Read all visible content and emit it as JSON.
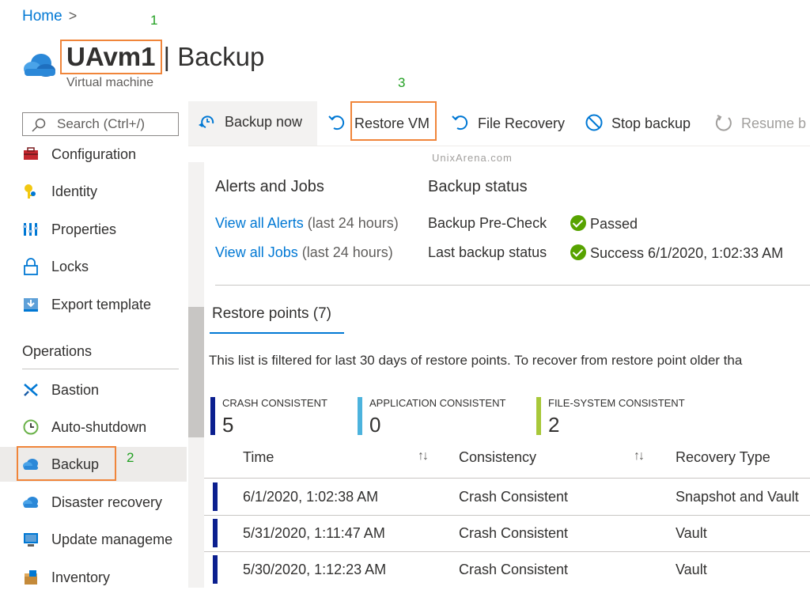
{
  "breadcrumb": {
    "home": "Home",
    "separator": ">"
  },
  "annotations": {
    "a1": "1",
    "a2": "2",
    "a3": "3"
  },
  "header": {
    "resource_name": "UAvm1",
    "blade": "| Backup",
    "subtitle": "Virtual machine"
  },
  "search": {
    "placeholder": "Search (Ctrl+/)"
  },
  "sidebar": {
    "items": [
      {
        "label": "Configuration",
        "icon": "toolbox-icon"
      },
      {
        "label": "Identity",
        "icon": "key-icon"
      },
      {
        "label": "Properties",
        "icon": "properties-icon"
      },
      {
        "label": "Locks",
        "icon": "lock-icon"
      },
      {
        "label": "Export template",
        "icon": "export-icon"
      }
    ],
    "section": "Operations",
    "operations": [
      {
        "label": "Bastion",
        "icon": "bastion-icon"
      },
      {
        "label": "Auto-shutdown",
        "icon": "clock-icon"
      },
      {
        "label": "Backup",
        "icon": "cloud-icon",
        "selected": true
      },
      {
        "label": "Disaster recovery",
        "icon": "cloud-icon"
      },
      {
        "label": "Update manageme",
        "icon": "monitor-icon"
      },
      {
        "label": "Inventory",
        "icon": "box-icon"
      }
    ]
  },
  "toolbar": {
    "backup_now": "Backup now",
    "restore_vm": "Restore VM",
    "file_recovery": "File Recovery",
    "stop_backup": "Stop backup",
    "resume_backup": "Resume b"
  },
  "watermark": "UnixArena.com",
  "alerts": {
    "heading": "Alerts and Jobs",
    "alerts_link": "View all Alerts",
    "alerts_note": "(last 24 hours)",
    "jobs_link": "View all Jobs",
    "jobs_note": "(last 24 hours)"
  },
  "backup_status": {
    "heading": "Backup status",
    "precheck_label": "Backup Pre-Check",
    "precheck_value": "Passed",
    "last_label": "Last backup status",
    "last_value": "Success 6/1/2020, 1:02:33 AM"
  },
  "restore_points": {
    "tab": "Restore points (7)",
    "note": "This list is filtered for last 30 days of restore points. To recover from restore point older tha",
    "stats": [
      {
        "label": "CRASH CONSISTENT",
        "value": "5",
        "color": "#0b1f8f"
      },
      {
        "label": "APPLICATION CONSISTENT",
        "value": "0",
        "color": "#4cb3dd"
      },
      {
        "label": "FILE-SYSTEM CONSISTENT",
        "value": "2",
        "color": "#a8c83a"
      }
    ],
    "columns": {
      "time": "Time",
      "consistency": "Consistency",
      "recovery_type": "Recovery Type",
      "sort": "↑↓"
    },
    "rows": [
      {
        "time": "6/1/2020, 1:02:38 AM",
        "consistency": "Crash Consistent",
        "type": "Snapshot and Vault"
      },
      {
        "time": "5/31/2020, 1:11:47 AM",
        "consistency": "Crash Consistent",
        "type": "Vault"
      },
      {
        "time": "5/30/2020, 1:12:23 AM",
        "consistency": "Crash Consistent",
        "type": "Vault"
      }
    ]
  },
  "colors": {
    "accent": "#0078d4",
    "highlight": "#f0853a",
    "success": "#57a300",
    "annotation": "#22a022"
  }
}
